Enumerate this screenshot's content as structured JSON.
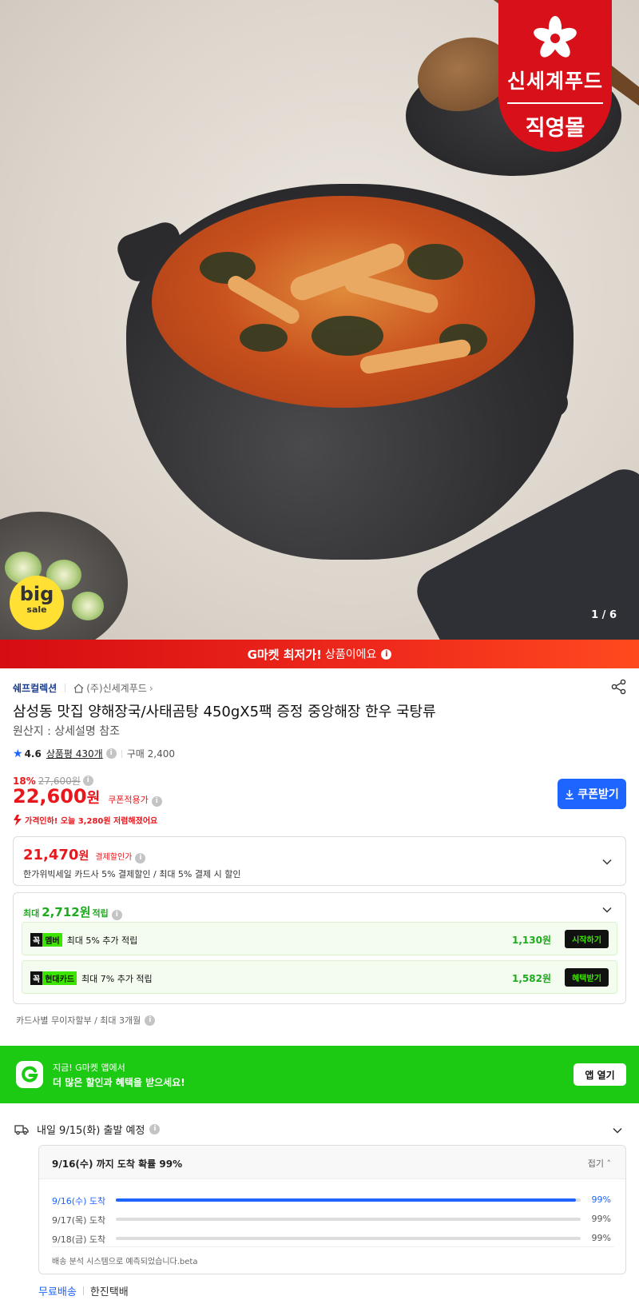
{
  "hero": {
    "brand_badge": {
      "name": "신세계푸드",
      "mall": "직영몰"
    },
    "big_sale": {
      "big": "big",
      "sale": "sale"
    },
    "pager": "1 / 6"
  },
  "lowest_banner": {
    "bold": "G마켓 최저가!",
    "text": "상품이에요"
  },
  "product": {
    "collection": "쉐프컬렉션",
    "seller": "(주)신세계푸드",
    "title": "삼성동 맛집 양해장국/사태곰탕 450gX5팩 증정 중앙해장 한우 국탕류",
    "origin": "원산지 : 상세설명 참조",
    "rating": "4.6",
    "reviews": "상품평 430개",
    "purchases": "구매 2,400"
  },
  "price": {
    "discount_rate": "18%",
    "original": "27,600원",
    "current": "22,600",
    "currency": "원",
    "coupon_note": "쿠폰적용가",
    "price_cut": "가격인하! 오늘 3,280원 저렴해졌어요",
    "coupon_button": "쿠폰받기"
  },
  "card_discount": {
    "amount": "21,470",
    "currency": "원",
    "label": "결제할인가",
    "desc": "한가위빅세일 카드사 5% 결제할인 / 최대 5% 결제 시 할인"
  },
  "reward": {
    "prefix": "최대",
    "amount": "2,712원",
    "suffix": "적립",
    "rows": [
      {
        "k": "꼭",
        "tag": "멤버",
        "text": "최대 5% 추가 적립",
        "amount": "1,130원",
        "button": "시작하기"
      },
      {
        "k": "꼭",
        "tag": "현대카드",
        "text": "최대 7% 추가 적립",
        "amount": "1,582원",
        "button": "혜택받기"
      }
    ]
  },
  "installment": "카드사별 무이자할부 / 최대 3개월",
  "app_banner": {
    "line1": "지금! G마켓 앱에서",
    "line2": "더 많은 할인과 혜택을 받으세요!",
    "button": "앱 열기"
  },
  "shipping": {
    "head": "내일 9/15(화) 출발 예정",
    "eta_title": "9/16(수) 까지 도착 확률 99%",
    "fold": "접기",
    "rows": [
      {
        "date": "9/16(수) 도착",
        "pct": "99%",
        "fill": 0.99
      },
      {
        "date": "9/17(목) 도착",
        "pct": "99%",
        "fill": 0
      },
      {
        "date": "9/18(금) 도착",
        "pct": "99%",
        "fill": 0
      }
    ],
    "note": "배송 분석 시스템으로 예측되었습니다.beta",
    "free": "무료배송",
    "carrier": "한진택배"
  },
  "colors": {
    "accent_red": "#e8171d",
    "accent_blue": "#1e64ff",
    "gmarket_green": "#1cca14",
    "brand_red": "#d7101a"
  },
  "icons": [
    "home-icon",
    "share-icon",
    "star-icon",
    "info-icon",
    "download-icon",
    "chevron-down-icon",
    "truck-icon",
    "gmarket-logo-icon",
    "price-down-arrow-icon"
  ]
}
